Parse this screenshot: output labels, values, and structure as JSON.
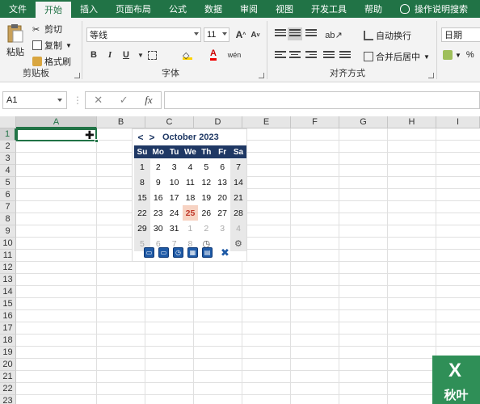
{
  "menu": {
    "tabs": [
      "文件",
      "开始",
      "插入",
      "页面布局",
      "公式",
      "数据",
      "审阅",
      "视图",
      "开发工具",
      "帮助"
    ],
    "active": "开始",
    "search": "操作说明搜索"
  },
  "ribbon": {
    "clipboard": {
      "paste": "粘贴",
      "cut": "剪切",
      "copy": "复制",
      "format_painter": "格式刷",
      "label": "剪贴板"
    },
    "font": {
      "name": "等线",
      "size": "11",
      "bold": "B",
      "italic": "I",
      "underline": "U",
      "label": "字体"
    },
    "alignment": {
      "wrap": "自动换行",
      "merge": "合并后居中",
      "label": "对齐方式"
    },
    "number": {
      "format": "日期",
      "percent": "%"
    }
  },
  "formula_bar": {
    "cell_ref": "A1",
    "cancel": "✕",
    "confirm": "✓",
    "fx": "fx",
    "value": ""
  },
  "grid": {
    "columns": [
      "A",
      "B",
      "C",
      "D",
      "E",
      "F",
      "G",
      "H",
      "I"
    ],
    "rows": [
      "1",
      "2",
      "3",
      "4",
      "5",
      "6",
      "7",
      "8",
      "9",
      "10",
      "11",
      "12",
      "13",
      "14",
      "15",
      "16",
      "17",
      "18",
      "19",
      "20",
      "21",
      "22",
      "23"
    ]
  },
  "calendar": {
    "prev": "<",
    "next": ">",
    "month_label": "October 2023",
    "weekdays": [
      "Su",
      "Mo",
      "Tu",
      "We",
      "Th",
      "Fr",
      "Sa"
    ],
    "weeks": [
      [
        "1",
        "2",
        "3",
        "4",
        "5",
        "6",
        "7"
      ],
      [
        "8",
        "9",
        "10",
        "11",
        "12",
        "13",
        "14"
      ],
      [
        "15",
        "16",
        "17",
        "18",
        "19",
        "20",
        "21"
      ],
      [
        "22",
        "23",
        "24",
        "25",
        "26",
        "27",
        "28"
      ],
      [
        "29",
        "30",
        "31",
        "1",
        "2",
        "3",
        "4"
      ],
      [
        "5",
        "6",
        "7",
        "8",
        "",
        ""
      ]
    ],
    "today": "25",
    "icons": [
      "clock-icon",
      "gear-icon"
    ],
    "toolbar_icons": [
      "window-icon",
      "window-icon",
      "time-icon",
      "calendar-icon",
      "calendar-grid-icon",
      "close-icon"
    ]
  },
  "watermark": {
    "letter": "X",
    "text": "秋叶"
  }
}
